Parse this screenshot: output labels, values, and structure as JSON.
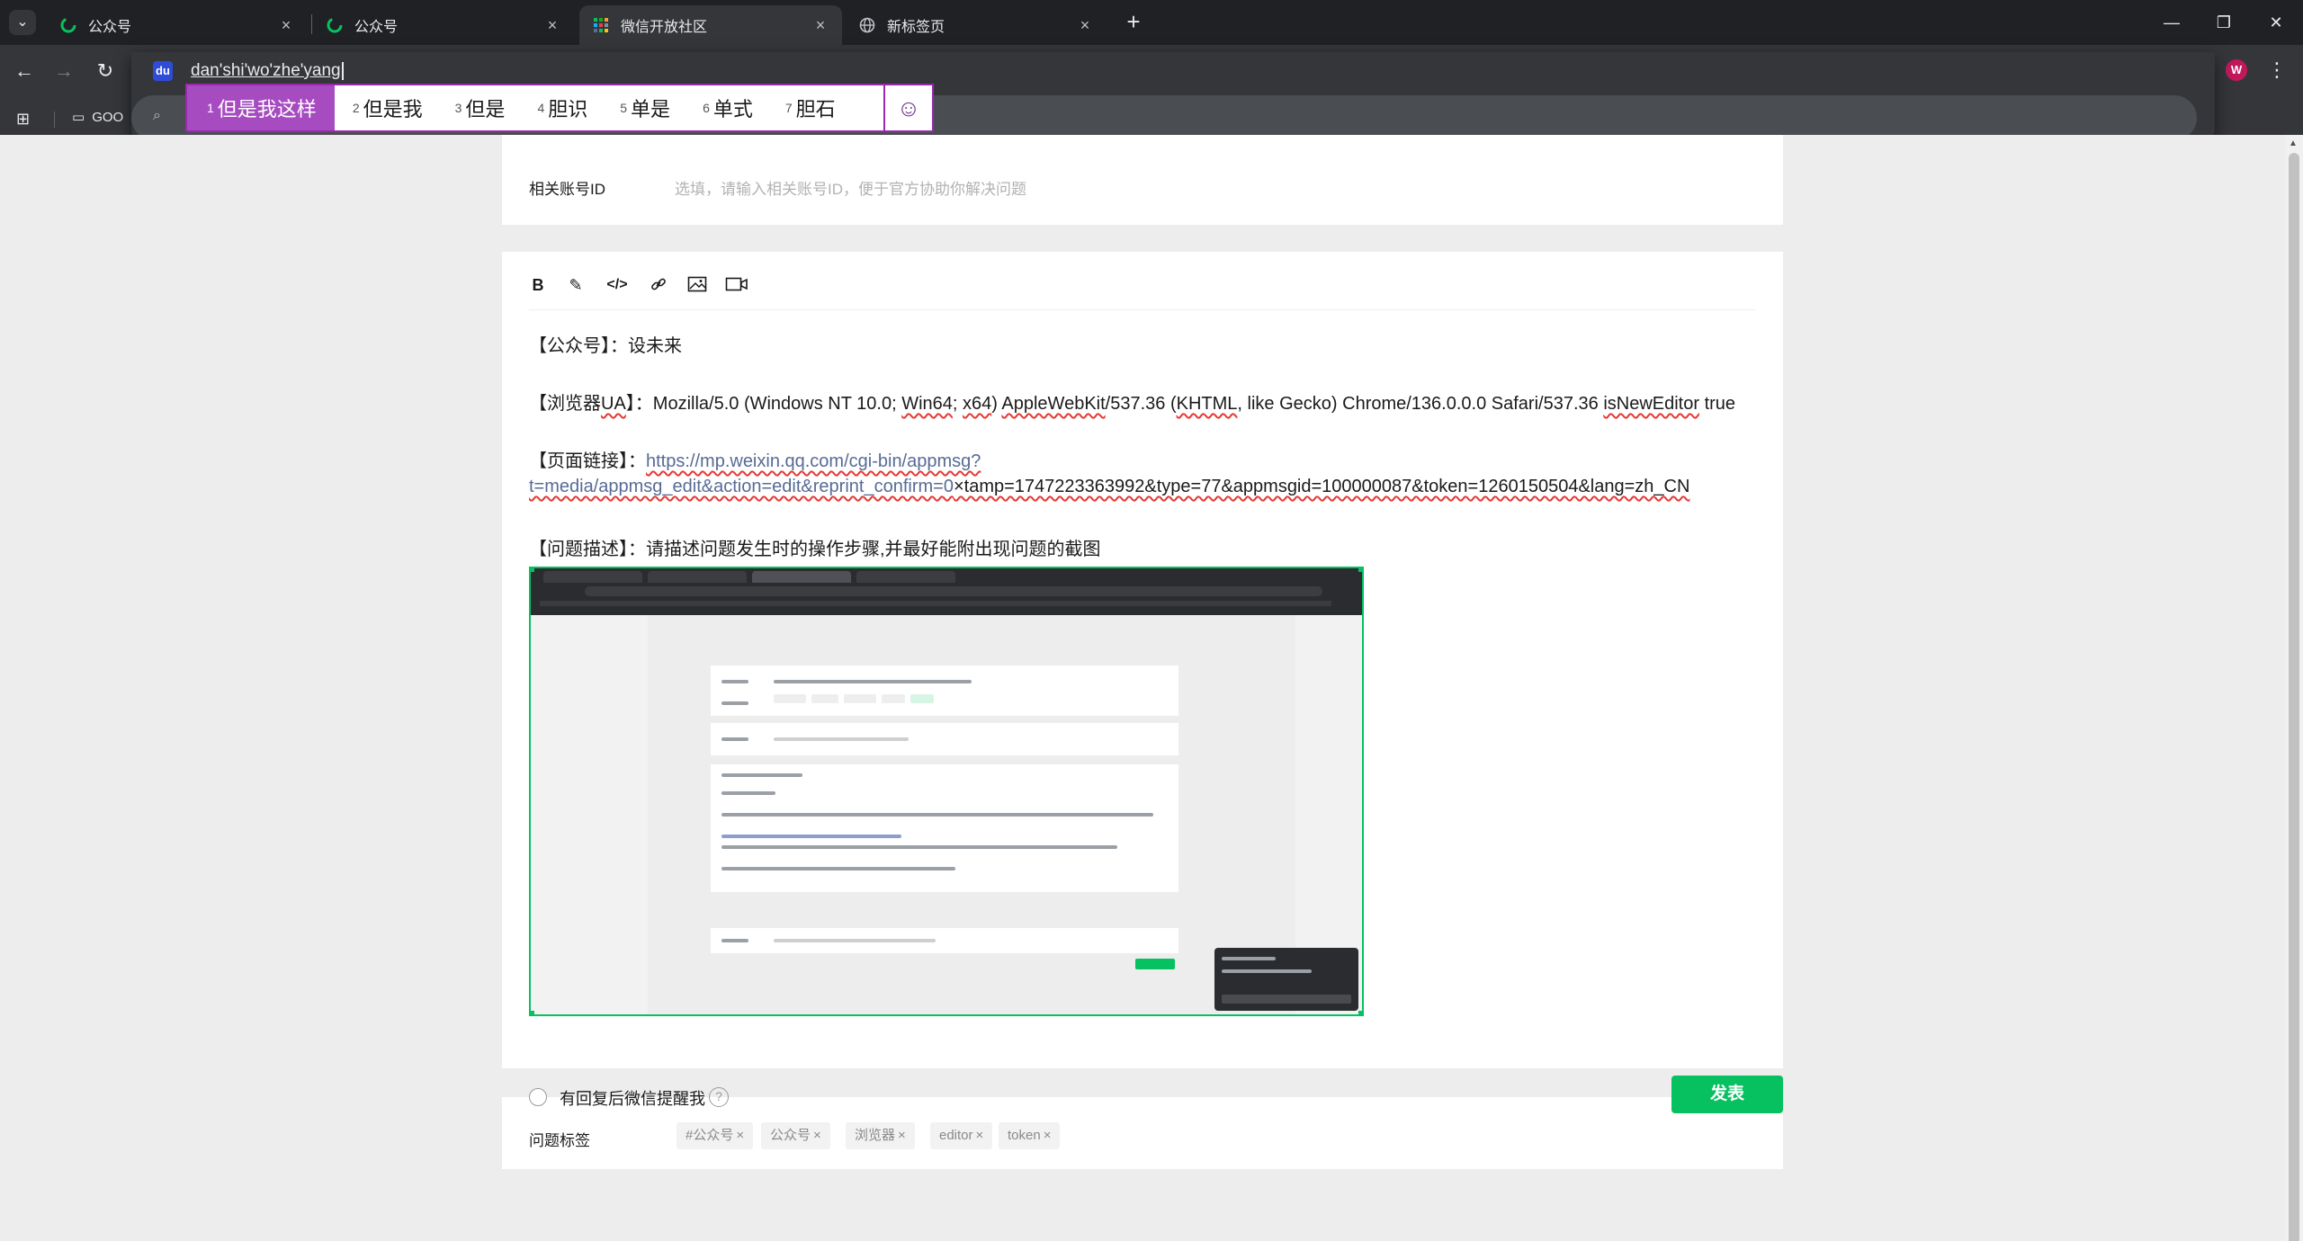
{
  "browser": {
    "tabs": [
      {
        "title": "公众号",
        "icon": "wechat-mp-icon",
        "active": false
      },
      {
        "title": "公众号",
        "icon": "wechat-mp-icon",
        "active": false
      },
      {
        "title": "微信开放社区",
        "icon": "wechat-open-community-icon",
        "active": true
      },
      {
        "title": "新标签页",
        "icon": "globe-icon",
        "active": false
      }
    ],
    "bookmark_folder": "GOO",
    "omnibox_text": "dan'shi'wo'zhe'yang",
    "profile_initial": "W"
  },
  "ime": {
    "candidates": [
      {
        "num": "1",
        "text": "但是我这样",
        "selected": true
      },
      {
        "num": "2",
        "text": "但是我"
      },
      {
        "num": "3",
        "text": "但是"
      },
      {
        "num": "4",
        "text": "胆识"
      },
      {
        "num": "5",
        "text": "单是"
      },
      {
        "num": "6",
        "text": "单式"
      },
      {
        "num": "7",
        "text": "胆石"
      }
    ],
    "emoji": "☺",
    "accent": "#9c27b0"
  },
  "form": {
    "account_id_label": "相关账号ID",
    "account_id_placeholder": "选填，请输入相关账号ID，便于官方协助你解决问题",
    "editor": {
      "toolbar": [
        "B",
        "✎",
        "</>",
        "🔗",
        "🖼",
        "▭"
      ],
      "line_account": "【公众号】：设未来",
      "line_ua_prefix": "【浏览器",
      "line_ua_tag": "UA",
      "line_ua_body_1": "】：Mozilla/5.0 (Windows NT 10.0; ",
      "line_ua_win64": "Win64",
      "line_ua_body_2": "; ",
      "line_ua_x64": "x64",
      "line_ua_body_3": ") ",
      "line_ua_applewebkit": "AppleWebKit",
      "line_ua_body_4": "/537.36 (",
      "line_ua_khtml": "KHTML",
      "line_ua_body_5": ", like Gecko) Chrome/136.0.0.0 Safari/537.36  ",
      "line_ua_isneweditor": "isNewEditor",
      "line_ua_body_6": " true",
      "line_link_label": "【页面链接】：",
      "line_link_url_1": "https://mp.weixin.qq.com/cgi-bin/appmsg?",
      "line_link_url_2": "t=media/appmsg_edit&action=edit&reprint_confirm=0",
      "line_link_url_3": "×tamp=1747223363992&type=77&appmsgid=100000087&token=1260150504&lang=zh_CN",
      "line_problem": "【问题描述】：请描述问题发生时的操作步骤,并最好能附出现问题的截图"
    },
    "tags_label": "问题标签",
    "tags": [
      "#公众号",
      "公众号",
      "浏览器",
      "editor",
      "token"
    ],
    "remind_label": "有回复后微信提醒我",
    "help_icon": "?",
    "publish_label": "发表"
  },
  "colors": {
    "primary_green": "#07c160",
    "link": "#576b95",
    "ime_selected": "#a64bc0"
  }
}
